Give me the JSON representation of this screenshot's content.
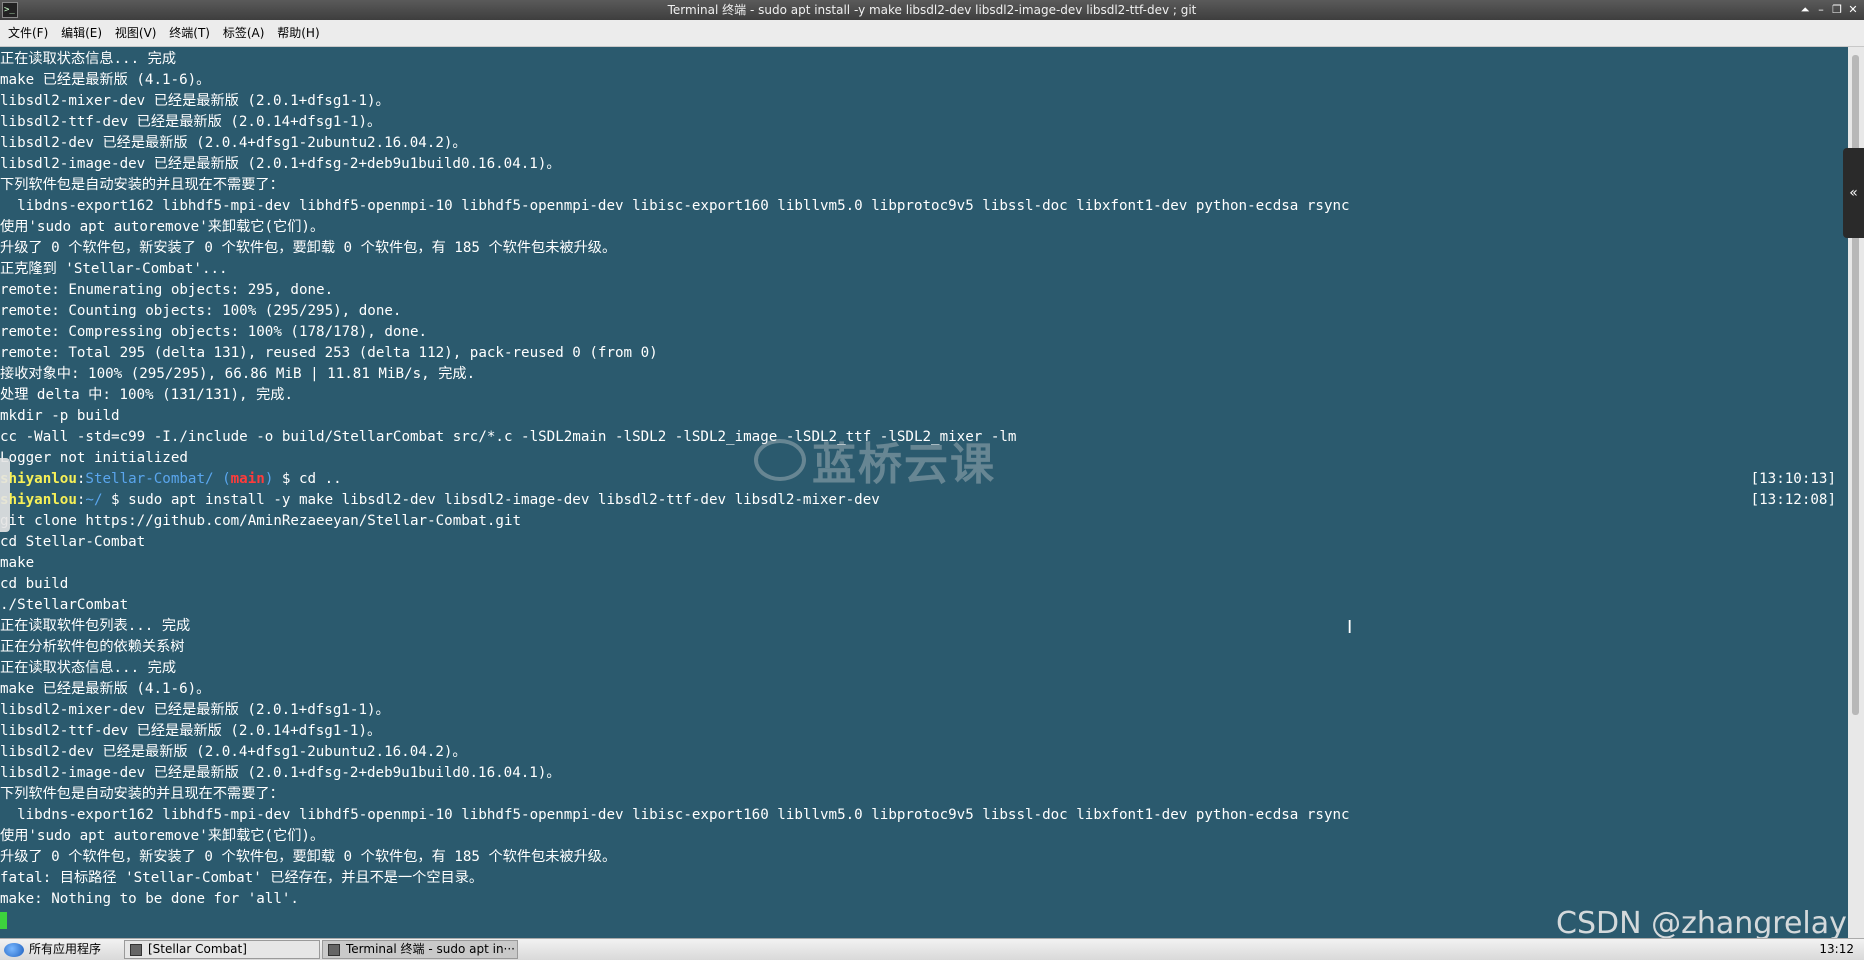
{
  "window": {
    "title": "Terminal 终端 - sudo apt install -y make libsdl2-dev libsdl2-image-dev libsdl2-ttf-dev ; git",
    "app_icon": "terminal-icon",
    "controls": [
      "⏶",
      "–",
      "❐",
      "✕"
    ]
  },
  "menu": [
    "文件(F)",
    "编辑(E)",
    "视图(V)",
    "终端(T)",
    "标签(A)",
    "帮助(H)"
  ],
  "terminal": {
    "lines": [
      {
        "t": "正在读取状态信息... 完成"
      },
      {
        "t": "make 已经是最新版 (4.1-6)。"
      },
      {
        "t": "libsdl2-mixer-dev 已经是最新版 (2.0.1+dfsg1-1)。"
      },
      {
        "t": "libsdl2-ttf-dev 已经是最新版 (2.0.14+dfsg1-1)。"
      },
      {
        "t": "libsdl2-dev 已经是最新版 (2.0.4+dfsg1-2ubuntu2.16.04.2)。"
      },
      {
        "t": "libsdl2-image-dev 已经是最新版 (2.0.1+dfsg-2+deb9u1build0.16.04.1)。"
      },
      {
        "t": "下列软件包是自动安装的并且现在不需要了："
      },
      {
        "t": "  libdns-export162 libhdf5-mpi-dev libhdf5-openmpi-10 libhdf5-openmpi-dev libisc-export160 libllvm5.0 libprotoc9v5 libssl-doc libxfont1-dev python-ecdsa rsync"
      },
      {
        "t": "使用'sudo apt autoremove'来卸载它(它们)。"
      },
      {
        "t": "升级了 0 个软件包，新安装了 0 个软件包，要卸载 0 个软件包，有 185 个软件包未被升级。"
      },
      {
        "t": "正克隆到 'Stellar-Combat'..."
      },
      {
        "t": "remote: Enumerating objects: 295, done."
      },
      {
        "t": "remote: Counting objects: 100% (295/295), done."
      },
      {
        "t": "remote: Compressing objects: 100% (178/178), done."
      },
      {
        "t": "remote: Total 295 (delta 131), reused 253 (delta 112), pack-reused 0 (from 0)"
      },
      {
        "t": "接收对象中: 100% (295/295), 66.86 MiB | 11.81 MiB/s, 完成."
      },
      {
        "t": "处理 delta 中: 100% (131/131), 完成."
      },
      {
        "t": "mkdir -p build"
      },
      {
        "t": "cc -Wall -std=c99 -I./include -o build/StellarCombat src/*.c -lSDL2main -lSDL2 -lSDL2_image -lSDL2_ttf -lSDL2_mixer -lm"
      },
      {
        "t": "Logger not initialized"
      },
      {
        "prompt": {
          "user": "shiyanlou",
          "colon": ":",
          "path": "Stellar-Combat/",
          "branch_open": " (",
          "branch": "main",
          "branch_close": ")",
          "cmd": " $ cd .."
        },
        "ts": "[13:10:13]"
      },
      {
        "prompt": {
          "user": "shiyanlou",
          "colon": ":",
          "path": "~/",
          "branch_open": "",
          "branch": "",
          "branch_close": "",
          "cmd": " $ sudo apt install -y make libsdl2-dev libsdl2-image-dev libsdl2-ttf-dev libsdl2-mixer-dev"
        },
        "ts": "[13:12:08]"
      },
      {
        "t": "git clone https://github.com/AminRezaeeyan/Stellar-Combat.git"
      },
      {
        "t": "cd Stellar-Combat"
      },
      {
        "t": "make"
      },
      {
        "t": "cd build"
      },
      {
        "t": "./StellarCombat"
      },
      {
        "t": "正在读取软件包列表... 完成"
      },
      {
        "t": "正在分析软件包的依赖关系树"
      },
      {
        "t": "正在读取状态信息... 完成"
      },
      {
        "t": "make 已经是最新版 (4.1-6)。"
      },
      {
        "t": "libsdl2-mixer-dev 已经是最新版 (2.0.1+dfsg1-1)。"
      },
      {
        "t": "libsdl2-ttf-dev 已经是最新版 (2.0.14+dfsg1-1)。"
      },
      {
        "t": "libsdl2-dev 已经是最新版 (2.0.4+dfsg1-2ubuntu2.16.04.2)。"
      },
      {
        "t": "libsdl2-image-dev 已经是最新版 (2.0.1+dfsg-2+deb9u1build0.16.04.1)。"
      },
      {
        "t": "下列软件包是自动安装的并且现在不需要了："
      },
      {
        "t": "  libdns-export162 libhdf5-mpi-dev libhdf5-openmpi-10 libhdf5-openmpi-dev libisc-export160 libllvm5.0 libprotoc9v5 libssl-doc libxfont1-dev python-ecdsa rsync"
      },
      {
        "t": "使用'sudo apt autoremove'来卸载它(它们)。"
      },
      {
        "t": "升级了 0 个软件包，新安装了 0 个软件包，要卸载 0 个软件包，有 185 个软件包未被升级。"
      },
      {
        "t": "fatal: 目标路径 'Stellar-Combat' 已经存在，并且不是一个空目录。"
      },
      {
        "t": "make: Nothing to be done for 'all'."
      },
      {
        "cursor": true
      }
    ]
  },
  "watermark": {
    "text": "蓝桥云课"
  },
  "overlay": {
    "csdn": "CSDN @zhangrelay",
    "side_toggle": "«",
    "ibeam": "Ⅰ"
  },
  "taskbar": {
    "start_label": "所有应用程序",
    "tasks": [
      {
        "label": "[Stellar Combat]",
        "active": false
      },
      {
        "label": "Terminal 终端 - sudo apt in···",
        "active": true
      }
    ],
    "clock": "13:12"
  },
  "colors": {
    "terminal_bg": "#2b5a6e",
    "prompt_user": "#f7f057",
    "prompt_path": "#5aa6ee",
    "prompt_branch": "#ff3b3b",
    "cursor": "#3dd23d"
  }
}
